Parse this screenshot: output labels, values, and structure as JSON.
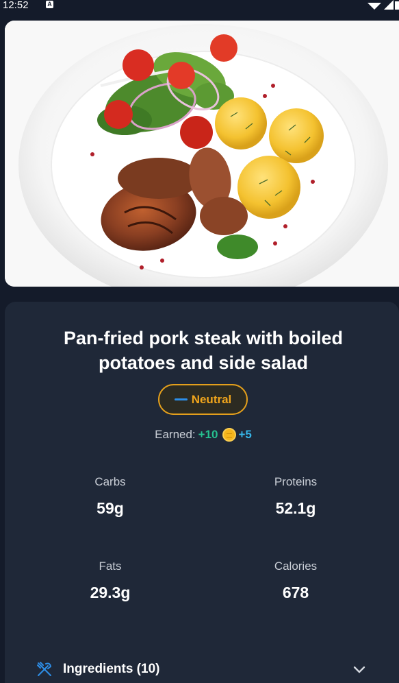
{
  "status_bar": {
    "time": "12:52",
    "indicator": "A"
  },
  "dish": {
    "title": "Pan-fried pork steak with boiled potatoes and side salad",
    "image_icon": "food-photo"
  },
  "rating": {
    "label": "Neutral",
    "color": "#f0a51c",
    "dash_color": "#2d8ee8"
  },
  "earned": {
    "label": "Earned:",
    "points": "+10",
    "coin_icon": "coin-icon",
    "coins": "+5"
  },
  "macros": {
    "carbs": {
      "label": "Carbs",
      "value": "59g"
    },
    "proteins": {
      "label": "Proteins",
      "value": "52.1g"
    },
    "fats": {
      "label": "Fats",
      "value": "29.3g"
    },
    "calories": {
      "label": "Calories",
      "value": "678"
    }
  },
  "ingredients": {
    "label": "Ingredients (10)",
    "icon": "cutlery-icon",
    "expand_icon": "chevron-down-icon"
  },
  "colors": {
    "background": "#141b2a",
    "card": "#1f2838",
    "accent_green": "#26c08f",
    "accent_blue": "#36b4e6"
  }
}
